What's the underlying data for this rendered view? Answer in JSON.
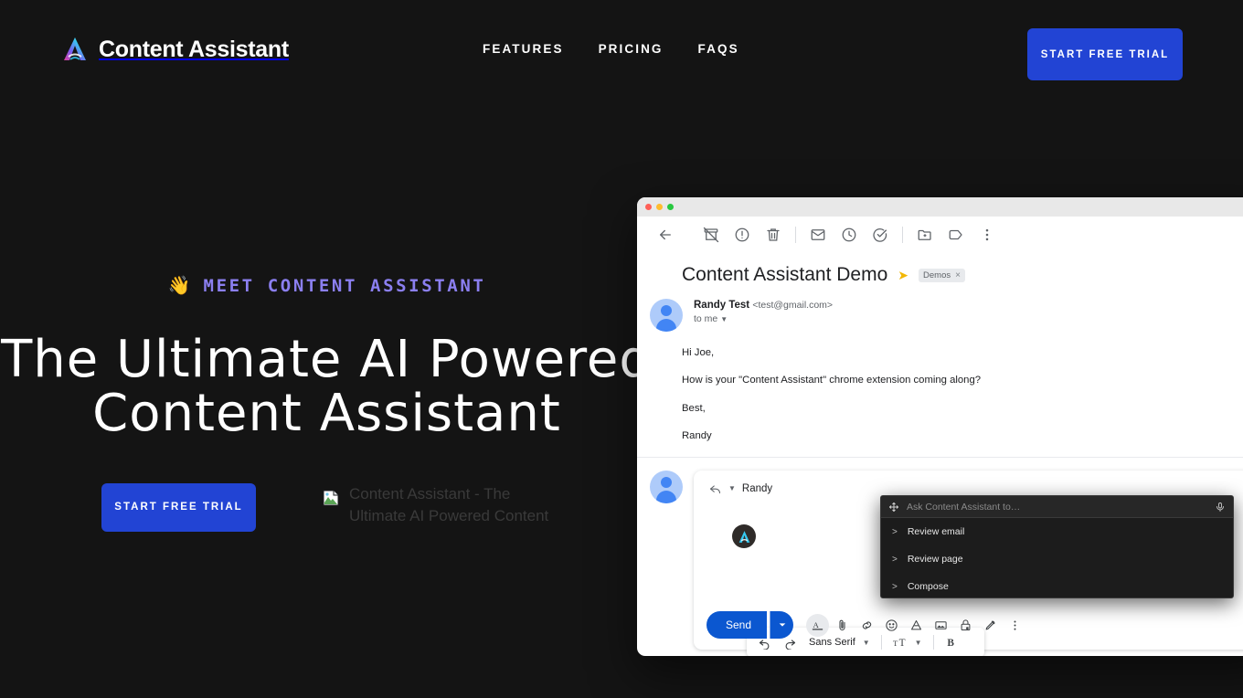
{
  "nav": {
    "brand": "Content Assistant",
    "brand_logo_icon": "content-assistant-logo-icon",
    "links": [
      {
        "label": "FEATURES"
      },
      {
        "label": "PRICING"
      },
      {
        "label": "FAQS"
      }
    ],
    "cta_label": "START FREE TRIAL"
  },
  "hero": {
    "eyebrow_emoji": "👋",
    "eyebrow": "MEET CONTENT ASSISTANT",
    "title": "The Ultimate AI Powered\nContent Assistant",
    "cta_label": "START FREE TRIAL",
    "broken_image_alt": "Content Assistant - The Ultimate AI Powered Content",
    "broken_image_icon": "broken-image-icon"
  },
  "colors": {
    "page_bg": "#141414",
    "accent_blue": "#2244d4",
    "eyebrow_purple": "#8b7ff0",
    "gmail_send_blue": "#0b57d0",
    "panel_bg": "#1c1c1c"
  },
  "gmail": {
    "window_dots": [
      "red",
      "yellow",
      "green"
    ],
    "toolbar_icons": [
      "back-arrow-icon",
      "archive-icon",
      "report-spam-icon",
      "delete-icon",
      "mark-unread-icon",
      "snooze-icon",
      "add-to-tasks-icon",
      "move-to-icon",
      "labels-icon",
      "more-options-icon"
    ],
    "subject": "Content Assistant Demo",
    "important_marker_icon": "important-marker-icon",
    "label_chip": "Demos",
    "label_chip_remove": "×",
    "sender_name": "Randy Test",
    "sender_email": "<test@gmail.com>",
    "recipient_line": "to me",
    "body_paragraphs": [
      "Hi Joe,",
      "How is your \"Content Assistant\" chrome extension coming along?",
      "Best,",
      "Randy"
    ],
    "reply": {
      "reply_icon": "reply-arrow-icon",
      "recipient": "Randy",
      "extension_badge_icon": "content-assistant-extension-icon",
      "more_formatting_icon": "more-formatting-icon",
      "format_bar": {
        "undo_icon": "undo-icon",
        "redo_icon": "redo-icon",
        "font_family": "Sans Serif",
        "font_size_icon": "font-size-icon",
        "bold_label": "B"
      },
      "send_label": "Send",
      "send_options_icon": "send-options-icon",
      "tool_icons": [
        "format-text-icon",
        "attach-file-icon",
        "insert-link-icon",
        "insert-emoji-icon",
        "insert-drive-file-icon",
        "insert-photo-icon",
        "confidential-mode-icon",
        "insert-signature-icon",
        "more-options-icon"
      ]
    }
  },
  "assistant_panel": {
    "drag_handle_icon": "drag-handle-icon",
    "input_placeholder": "Ask Content Assistant to…",
    "mic_icon": "microphone-icon",
    "items": [
      {
        "label": "Review email"
      },
      {
        "label": "Review page"
      },
      {
        "label": "Compose"
      }
    ]
  }
}
